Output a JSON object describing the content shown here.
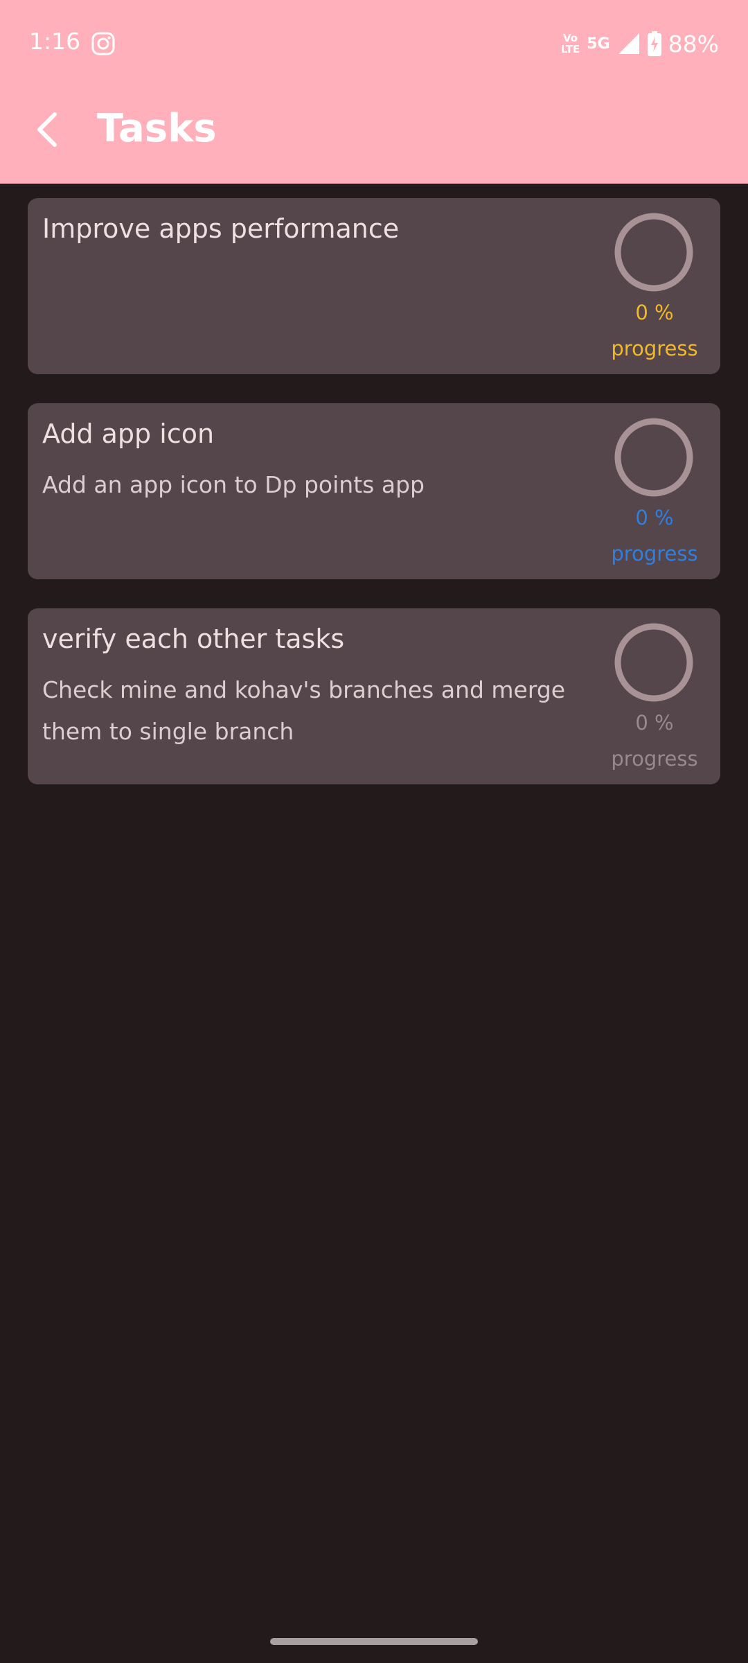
{
  "status_bar": {
    "time": "1:16",
    "volte_top": "Vo",
    "volte_bottom": "LTE",
    "network": "5G",
    "battery": "88%"
  },
  "header": {
    "title": "Tasks"
  },
  "colors": {
    "topbar": "#ffb0bb",
    "background": "#231a1b",
    "card": "#54464a",
    "ring": "#a99296"
  },
  "tasks": [
    {
      "title": "Improve apps performance",
      "description": "",
      "progress": 0,
      "percent_text": "0 %",
      "progress_label": "progress",
      "accent": "#f2b827"
    },
    {
      "title": "Add app icon",
      "description": "Add an app icon to Dp points app",
      "progress": 0,
      "percent_text": "0 %",
      "progress_label": "progress",
      "accent": "#2f7fe0"
    },
    {
      "title": "verify each other tasks",
      "description": "Check mine and kohav's branches and merge them to single branch",
      "progress": 0,
      "percent_text": "0 %",
      "progress_label": "progress",
      "accent": "#968a8d"
    }
  ]
}
